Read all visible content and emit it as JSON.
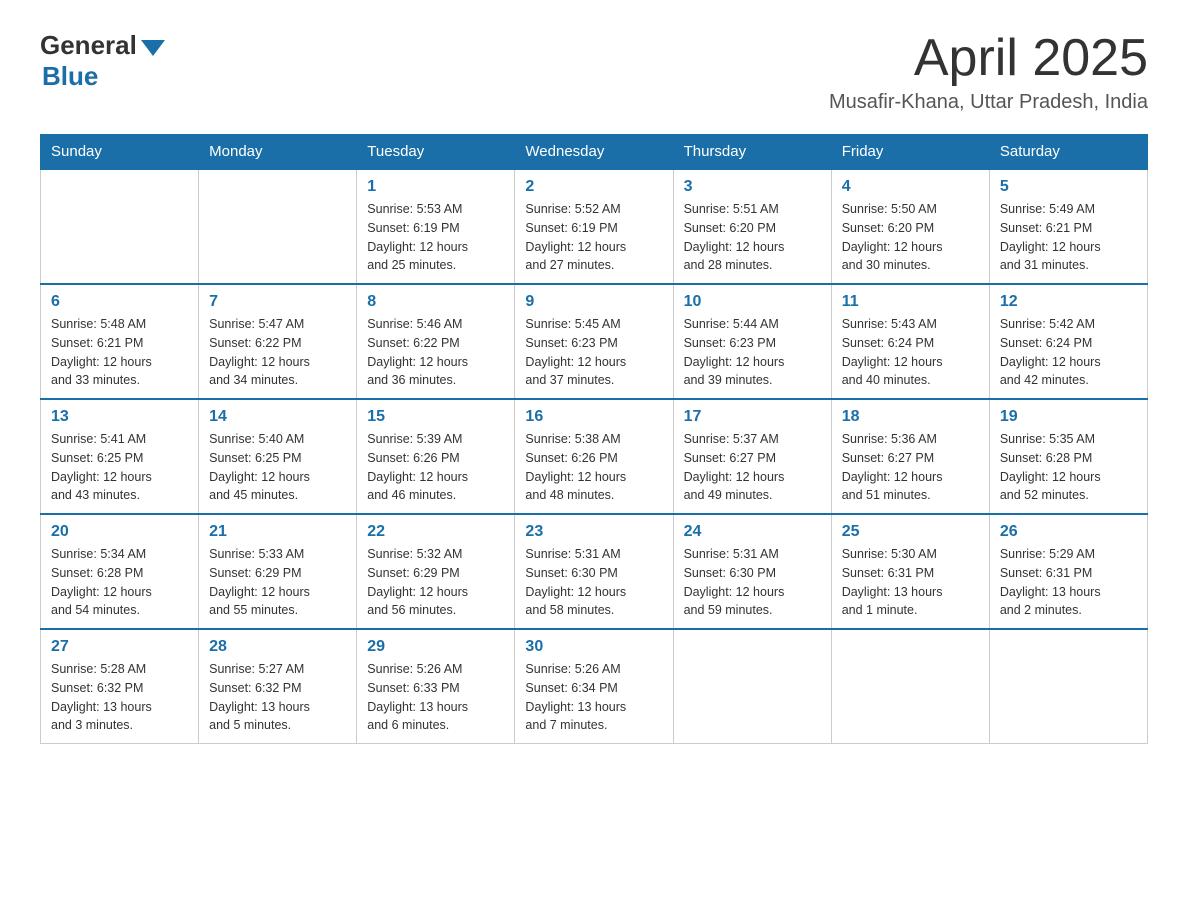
{
  "header": {
    "logo_line1": "General",
    "logo_line2": "Blue",
    "month_title": "April 2025",
    "location": "Musafir-Khana, Uttar Pradesh, India"
  },
  "weekdays": [
    "Sunday",
    "Monday",
    "Tuesday",
    "Wednesday",
    "Thursday",
    "Friday",
    "Saturday"
  ],
  "weeks": [
    [
      {
        "num": "",
        "info": ""
      },
      {
        "num": "",
        "info": ""
      },
      {
        "num": "1",
        "info": "Sunrise: 5:53 AM\nSunset: 6:19 PM\nDaylight: 12 hours\nand 25 minutes."
      },
      {
        "num": "2",
        "info": "Sunrise: 5:52 AM\nSunset: 6:19 PM\nDaylight: 12 hours\nand 27 minutes."
      },
      {
        "num": "3",
        "info": "Sunrise: 5:51 AM\nSunset: 6:20 PM\nDaylight: 12 hours\nand 28 minutes."
      },
      {
        "num": "4",
        "info": "Sunrise: 5:50 AM\nSunset: 6:20 PM\nDaylight: 12 hours\nand 30 minutes."
      },
      {
        "num": "5",
        "info": "Sunrise: 5:49 AM\nSunset: 6:21 PM\nDaylight: 12 hours\nand 31 minutes."
      }
    ],
    [
      {
        "num": "6",
        "info": "Sunrise: 5:48 AM\nSunset: 6:21 PM\nDaylight: 12 hours\nand 33 minutes."
      },
      {
        "num": "7",
        "info": "Sunrise: 5:47 AM\nSunset: 6:22 PM\nDaylight: 12 hours\nand 34 minutes."
      },
      {
        "num": "8",
        "info": "Sunrise: 5:46 AM\nSunset: 6:22 PM\nDaylight: 12 hours\nand 36 minutes."
      },
      {
        "num": "9",
        "info": "Sunrise: 5:45 AM\nSunset: 6:23 PM\nDaylight: 12 hours\nand 37 minutes."
      },
      {
        "num": "10",
        "info": "Sunrise: 5:44 AM\nSunset: 6:23 PM\nDaylight: 12 hours\nand 39 minutes."
      },
      {
        "num": "11",
        "info": "Sunrise: 5:43 AM\nSunset: 6:24 PM\nDaylight: 12 hours\nand 40 minutes."
      },
      {
        "num": "12",
        "info": "Sunrise: 5:42 AM\nSunset: 6:24 PM\nDaylight: 12 hours\nand 42 minutes."
      }
    ],
    [
      {
        "num": "13",
        "info": "Sunrise: 5:41 AM\nSunset: 6:25 PM\nDaylight: 12 hours\nand 43 minutes."
      },
      {
        "num": "14",
        "info": "Sunrise: 5:40 AM\nSunset: 6:25 PM\nDaylight: 12 hours\nand 45 minutes."
      },
      {
        "num": "15",
        "info": "Sunrise: 5:39 AM\nSunset: 6:26 PM\nDaylight: 12 hours\nand 46 minutes."
      },
      {
        "num": "16",
        "info": "Sunrise: 5:38 AM\nSunset: 6:26 PM\nDaylight: 12 hours\nand 48 minutes."
      },
      {
        "num": "17",
        "info": "Sunrise: 5:37 AM\nSunset: 6:27 PM\nDaylight: 12 hours\nand 49 minutes."
      },
      {
        "num": "18",
        "info": "Sunrise: 5:36 AM\nSunset: 6:27 PM\nDaylight: 12 hours\nand 51 minutes."
      },
      {
        "num": "19",
        "info": "Sunrise: 5:35 AM\nSunset: 6:28 PM\nDaylight: 12 hours\nand 52 minutes."
      }
    ],
    [
      {
        "num": "20",
        "info": "Sunrise: 5:34 AM\nSunset: 6:28 PM\nDaylight: 12 hours\nand 54 minutes."
      },
      {
        "num": "21",
        "info": "Sunrise: 5:33 AM\nSunset: 6:29 PM\nDaylight: 12 hours\nand 55 minutes."
      },
      {
        "num": "22",
        "info": "Sunrise: 5:32 AM\nSunset: 6:29 PM\nDaylight: 12 hours\nand 56 minutes."
      },
      {
        "num": "23",
        "info": "Sunrise: 5:31 AM\nSunset: 6:30 PM\nDaylight: 12 hours\nand 58 minutes."
      },
      {
        "num": "24",
        "info": "Sunrise: 5:31 AM\nSunset: 6:30 PM\nDaylight: 12 hours\nand 59 minutes."
      },
      {
        "num": "25",
        "info": "Sunrise: 5:30 AM\nSunset: 6:31 PM\nDaylight: 13 hours\nand 1 minute."
      },
      {
        "num": "26",
        "info": "Sunrise: 5:29 AM\nSunset: 6:31 PM\nDaylight: 13 hours\nand 2 minutes."
      }
    ],
    [
      {
        "num": "27",
        "info": "Sunrise: 5:28 AM\nSunset: 6:32 PM\nDaylight: 13 hours\nand 3 minutes."
      },
      {
        "num": "28",
        "info": "Sunrise: 5:27 AM\nSunset: 6:32 PM\nDaylight: 13 hours\nand 5 minutes."
      },
      {
        "num": "29",
        "info": "Sunrise: 5:26 AM\nSunset: 6:33 PM\nDaylight: 13 hours\nand 6 minutes."
      },
      {
        "num": "30",
        "info": "Sunrise: 5:26 AM\nSunset: 6:34 PM\nDaylight: 13 hours\nand 7 minutes."
      },
      {
        "num": "",
        "info": ""
      },
      {
        "num": "",
        "info": ""
      },
      {
        "num": "",
        "info": ""
      }
    ]
  ]
}
